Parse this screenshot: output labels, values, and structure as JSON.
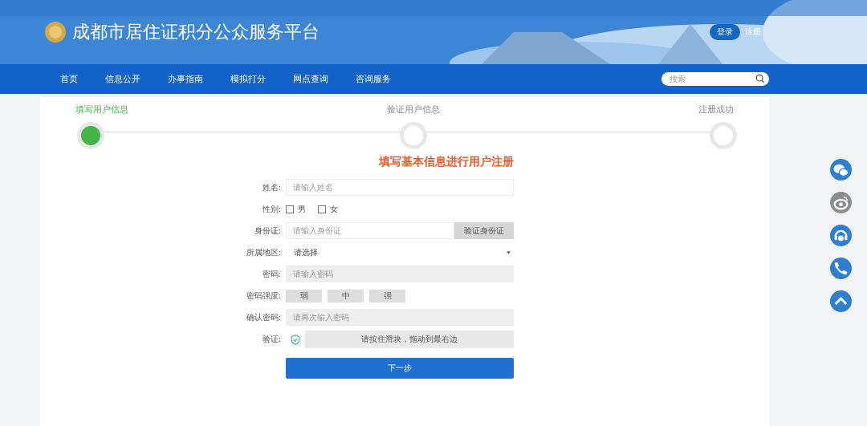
{
  "header": {
    "title": "成都市居住证积分公众服务平台",
    "login": "登录",
    "register": "注册"
  },
  "nav": {
    "items": [
      {
        "label": "首页",
        "selected": false
      },
      {
        "label": "信息公开",
        "selected": false
      },
      {
        "label": "办事指南",
        "selected": false
      },
      {
        "label": "模拟打分",
        "selected": false
      },
      {
        "label": "网点查询",
        "selected": false
      },
      {
        "label": "咨询服务",
        "selected": false
      }
    ],
    "search": {
      "placeholder": "搜索"
    }
  },
  "steps": [
    {
      "label": "填写用户信息",
      "selected": true
    },
    {
      "label": "验证用户信息",
      "selected": false
    },
    {
      "label": "注册成功",
      "selected": false
    }
  ],
  "form": {
    "heading": "填写基本信息进行用户注册",
    "rows": [
      {
        "kind": "text",
        "label": "姓名:",
        "placeholder": "请输入姓名"
      },
      {
        "kind": "gender",
        "label": "性别:",
        "options": [
          {
            "label": "男",
            "checked": false
          },
          {
            "label": "女",
            "checked": false
          }
        ]
      },
      {
        "kind": "idcard",
        "label": "身份证:",
        "placeholder": "请输入身份证",
        "button": "验证身份证"
      },
      {
        "kind": "select",
        "label": "所属地区:",
        "value": "请选择"
      },
      {
        "kind": "password",
        "label": "密码:",
        "placeholder": "请输入密码"
      },
      {
        "kind": "strength",
        "label": "密码强度:",
        "levels": [
          {
            "label": "弱",
            "selected": false
          },
          {
            "label": "中",
            "selected": false
          },
          {
            "label": "强",
            "selected": false
          }
        ]
      },
      {
        "kind": "password",
        "label": "确认密码:",
        "placeholder": "请再次输入密码"
      },
      {
        "kind": "slider",
        "label": "验证:",
        "hint": "请按住滑块，拖动到最右边"
      }
    ],
    "submit": "下一步"
  }
}
